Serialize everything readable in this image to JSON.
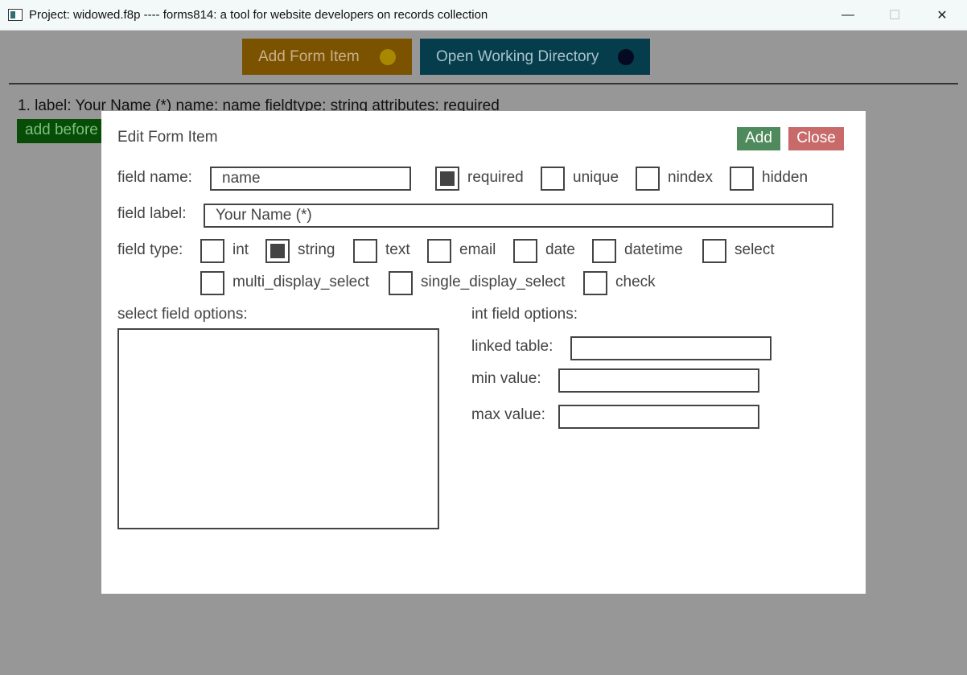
{
  "window": {
    "title": "Project: widowed.f8p ---- forms814: a tool for website developers on records collection",
    "minimize_icon": "—",
    "maximize_icon": "☐",
    "close_icon": "✕"
  },
  "toolbar": {
    "add_form_item": "Add Form Item",
    "open_working_directory": "Open Working Directory"
  },
  "form_items": [
    {
      "text": "1. label: Your Name (*) name: name fieldtype: string attributes: required",
      "add_before": "add before"
    }
  ],
  "dialog": {
    "title": "Edit Form Item",
    "add_label": "Add",
    "close_label": "Close",
    "field_name_label": "field name:",
    "field_name_value": "name",
    "attributes": [
      {
        "label": "required",
        "checked": true
      },
      {
        "label": "unique",
        "checked": false
      },
      {
        "label": "nindex",
        "checked": false
      },
      {
        "label": "hidden",
        "checked": false
      }
    ],
    "field_label_label": "field label:",
    "field_label_value": "Your Name (*)",
    "field_type_label": "field type:",
    "field_types": [
      {
        "label": "int",
        "checked": false
      },
      {
        "label": "string",
        "checked": true
      },
      {
        "label": "text",
        "checked": false
      },
      {
        "label": "email",
        "checked": false
      },
      {
        "label": "date",
        "checked": false
      },
      {
        "label": "datetime",
        "checked": false
      },
      {
        "label": "select",
        "checked": false
      },
      {
        "label": "multi_display_select",
        "checked": false
      },
      {
        "label": "single_display_select",
        "checked": false
      },
      {
        "label": "check",
        "checked": false
      }
    ],
    "select_field_options_label": "select field options:",
    "select_field_options_value": "",
    "int_field_options_label": "int field options:",
    "linked_table_label": "linked table:",
    "linked_table_value": "",
    "min_value_label": "min value:",
    "min_value_value": "",
    "max_value_label": "max value:",
    "max_value_value": ""
  },
  "colors": {
    "add_form_item_bg": "#7a5200",
    "open_dir_bg": "#053d4d",
    "add_button_bg": "#4f8a5c",
    "close_button_bg": "#c96a6a",
    "add_before_bg": "#074d07"
  }
}
